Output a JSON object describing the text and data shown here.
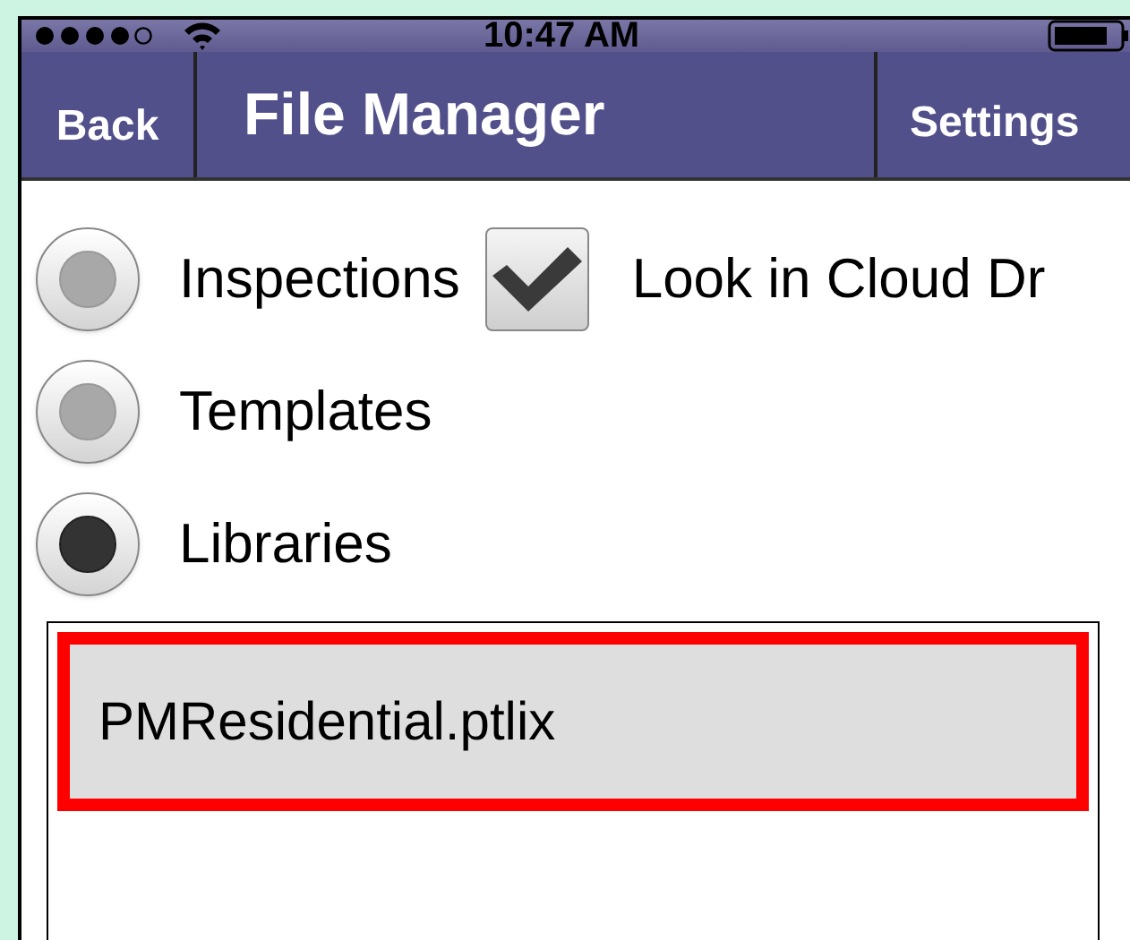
{
  "status_bar": {
    "time": "10:47 AM"
  },
  "nav_bar": {
    "back": "Back",
    "title": "File Manager",
    "settings": "Settings"
  },
  "sources": [
    {
      "label": "Inspections",
      "selected": false
    },
    {
      "label": "Templates",
      "selected": false
    },
    {
      "label": "Libraries",
      "selected": true
    }
  ],
  "cloud_checkbox": {
    "label": "Look in Cloud Dr",
    "checked": true
  },
  "files": [
    {
      "name": "PMResidential.ptlix",
      "selected": true,
      "highlighted": true
    }
  ]
}
